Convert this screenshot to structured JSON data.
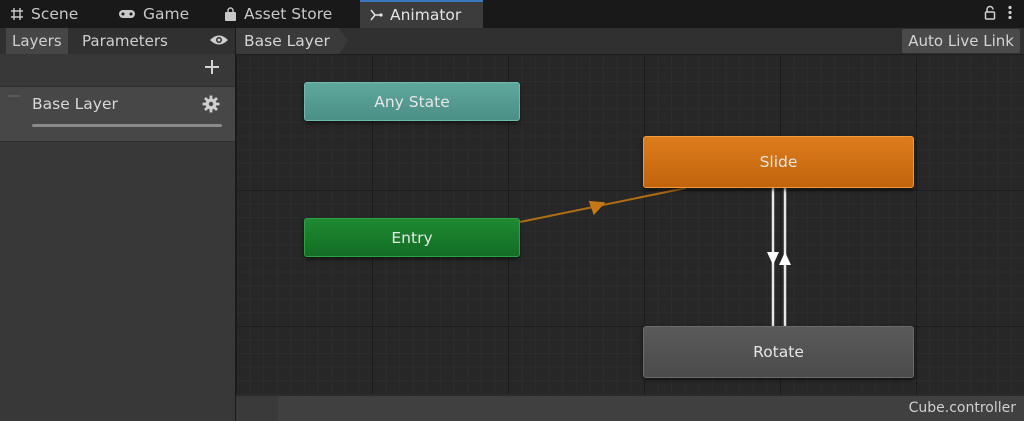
{
  "tabs": [
    {
      "label": "Scene",
      "icon": "grid-icon"
    },
    {
      "label": "Game",
      "icon": "gamepad-icon"
    },
    {
      "label": "Asset Store",
      "icon": "shopping-bag-icon"
    },
    {
      "label": "Animator",
      "icon": "animator-icon",
      "active": true
    }
  ],
  "window_icons": [
    "lock-icon",
    "more-icon"
  ],
  "left_panel": {
    "tabs": [
      {
        "label": "Layers",
        "active": true
      },
      {
        "label": "Parameters"
      }
    ],
    "eye_icon": "eye-icon",
    "add_icon": "plus-icon",
    "layers": [
      {
        "name": "Base Layer",
        "settings_icon": "gear-icon"
      }
    ]
  },
  "breadcrumb": {
    "label": "Base Layer"
  },
  "toolbar": {
    "live_link_label": "Auto Live Link"
  },
  "graph": {
    "states": [
      {
        "name": "Any State",
        "color": "#5fa79d"
      },
      {
        "name": "Entry",
        "color": "#1f8a33"
      },
      {
        "name": "Slide",
        "color": "#dd7c1d",
        "default": true
      },
      {
        "name": "Rotate",
        "color": "#5a5a5a"
      }
    ],
    "transitions": [
      {
        "from": "Entry",
        "to": "Slide",
        "color": "#b06d14"
      },
      {
        "from": "Slide",
        "to": "Rotate",
        "color": "#ffffff"
      },
      {
        "from": "Rotate",
        "to": "Slide",
        "color": "#ffffff"
      }
    ]
  },
  "status": {
    "controller_name": "Cube.controller"
  },
  "colors": {
    "accent": "#3a79bb",
    "background": "#191919",
    "graph_bg": "#272727"
  }
}
